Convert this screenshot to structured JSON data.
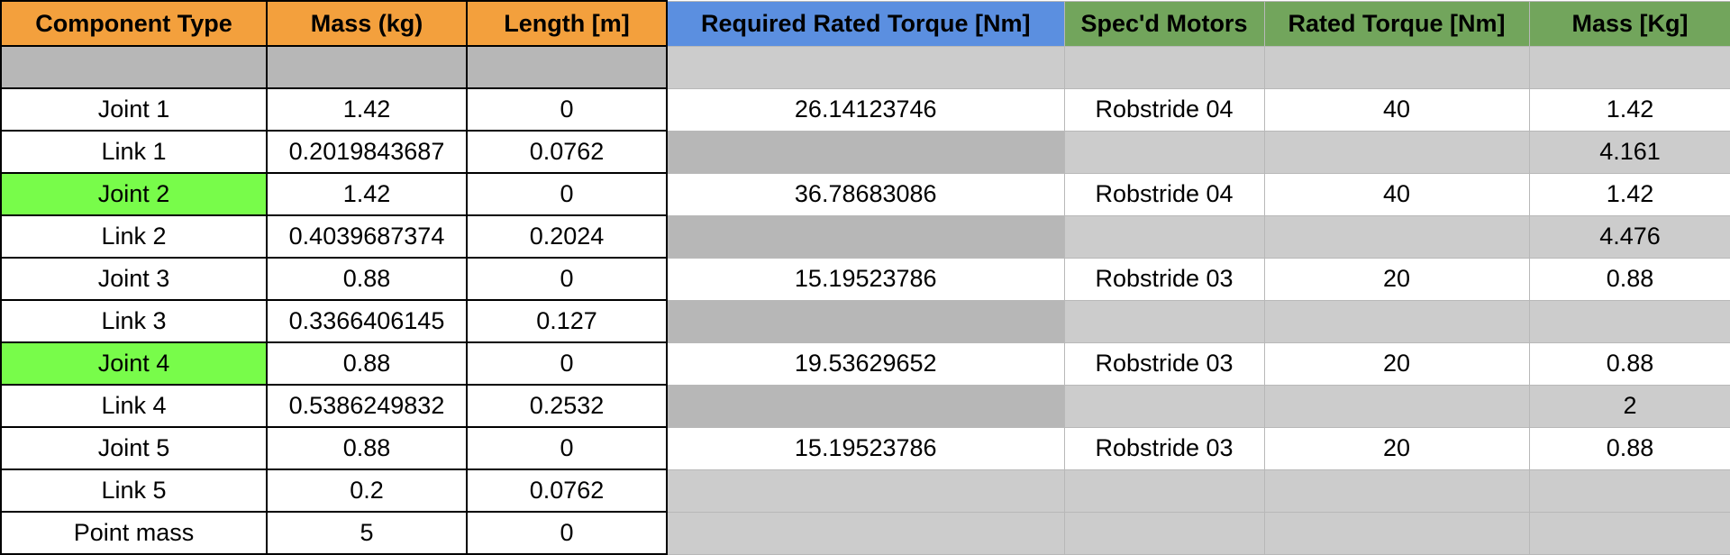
{
  "headers": [
    "Component Type",
    "Mass (kg)",
    "Length [m]",
    "Required Rated Torque [Nm]",
    "Spec'd Motors",
    "Rated Torque [Nm]",
    "Mass [Kg]"
  ],
  "rows": [
    [
      "",
      "",
      "",
      "",
      "",
      "",
      ""
    ],
    [
      "Joint 1",
      "1.42",
      "0",
      "26.14123746",
      "Robstride 04",
      "40",
      "1.42"
    ],
    [
      "Link 1",
      "0.2019843687",
      "0.0762",
      "",
      "",
      "",
      "4.161"
    ],
    [
      "Joint 2",
      "1.42",
      "0",
      "36.78683086",
      "Robstride 04",
      "40",
      "1.42"
    ],
    [
      "Link 2",
      "0.4039687374",
      "0.2024",
      "",
      "",
      "",
      "4.476"
    ],
    [
      "Joint 3",
      "0.88",
      "0",
      "15.19523786",
      "Robstride 03",
      "20",
      "0.88"
    ],
    [
      "Link 3",
      "0.3366406145",
      "0.127",
      "",
      "",
      "",
      ""
    ],
    [
      "Joint 4",
      "0.88",
      "0",
      "19.53629652",
      "Robstride 03",
      "20",
      "0.88"
    ],
    [
      "Link 4",
      "0.5386249832",
      "0.2532",
      "",
      "",
      "",
      "2"
    ],
    [
      "Joint 5",
      "0.88",
      "0",
      "15.19523786",
      "Robstride 03",
      "20",
      "0.88"
    ],
    [
      "Link 5",
      "0.2",
      "0.0762",
      "",
      "",
      "",
      ""
    ],
    [
      "Point mass",
      "5",
      "0",
      "",
      "",
      "",
      ""
    ]
  ],
  "colors": {
    "header_orange": "#f3a03d",
    "header_blue": "#5b8fe0",
    "header_green": "#72a55c",
    "highlight_lime": "#78fc4a",
    "gray_dark": "#b7b7b7",
    "gray_light": "#cccccc"
  }
}
